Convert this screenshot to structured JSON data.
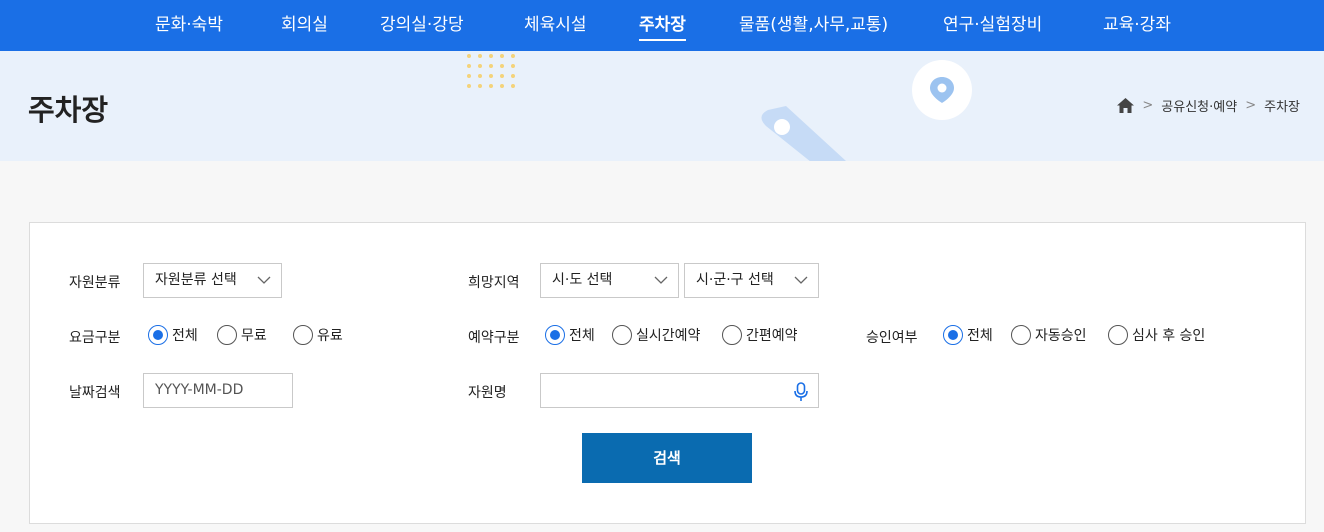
{
  "nav": {
    "items": [
      {
        "label": "문화·숙박"
      },
      {
        "label": "회의실"
      },
      {
        "label": "강의실·강당"
      },
      {
        "label": "체육시설"
      },
      {
        "label": "주차장"
      },
      {
        "label": "물품(생활,사무,교통)"
      },
      {
        "label": "연구·실험장비"
      },
      {
        "label": "교육·강좌"
      }
    ],
    "active_label": "주차장"
  },
  "header": {
    "title": "주차장",
    "breadcrumb": [
      {
        "label": "home-icon"
      },
      {
        "label": "공유신청·예약"
      },
      {
        "label": "주차장"
      }
    ]
  },
  "search": {
    "resource_type": {
      "label": "자원분류",
      "value": "자원분류 선택"
    },
    "region": {
      "label": "희망지역",
      "sido": "시·도 선택",
      "sigungu": "시·군·구 선택"
    },
    "fee": {
      "label": "요금구분",
      "options": [
        {
          "label": "전체",
          "checked": true
        },
        {
          "label": "무료"
        },
        {
          "label": "유료"
        }
      ]
    },
    "reservation": {
      "label": "예약구분",
      "options": [
        {
          "label": "전체",
          "checked": true
        },
        {
          "label": "실시간예약"
        },
        {
          "label": "간편예약"
        }
      ]
    },
    "approval": {
      "label": "승인여부",
      "options": [
        {
          "label": "전체",
          "checked": true
        },
        {
          "label": "자동승인"
        },
        {
          "label": "심사 후 승인"
        }
      ]
    },
    "date": {
      "label": "날짜검색",
      "placeholder": "YYYY-MM-DD"
    },
    "name": {
      "label": "자원명",
      "value": ""
    },
    "submit_label": "검색"
  },
  "colors": {
    "nav_bg": "#1a6fe6",
    "banner_bg": "#e9f1fb",
    "button_bg": "#0a6bb0",
    "radio_accent": "#1a6fe6"
  }
}
